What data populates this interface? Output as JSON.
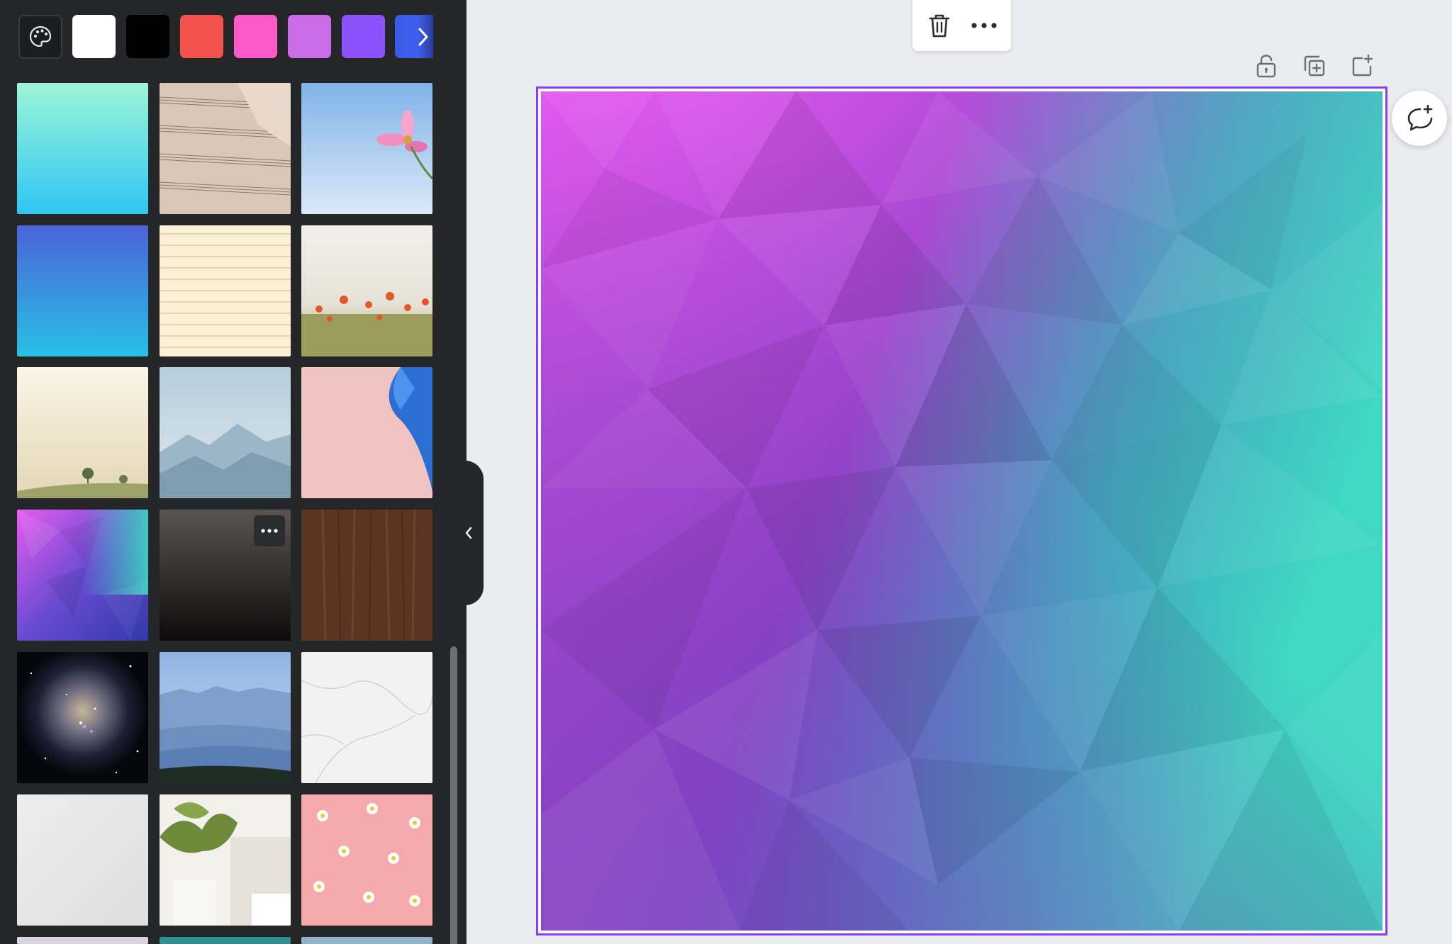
{
  "side_panel": {
    "palette_button": {
      "icon": "palette-icon"
    },
    "color_swatches": [
      {
        "name": "white",
        "color": "#ffffff"
      },
      {
        "name": "black",
        "color": "#000000"
      },
      {
        "name": "coral-red",
        "color": "#f4524d"
      },
      {
        "name": "pink",
        "color": "#ff5bc8"
      },
      {
        "name": "light-purple",
        "color": "#cb6ce6"
      },
      {
        "name": "violet",
        "color": "#8c52ff"
      },
      {
        "name": "blue",
        "color": "#3c5ae8"
      }
    ],
    "swatch_more": {
      "icon": "chevron-right-icon"
    },
    "backgrounds": [
      {
        "id": "mint-gradient"
      },
      {
        "id": "sheet-music"
      },
      {
        "id": "pink-cosmos-sky"
      },
      {
        "id": "blue-gradient-texture"
      },
      {
        "id": "lined-paper"
      },
      {
        "id": "poppy-field"
      },
      {
        "id": "misty-road"
      },
      {
        "id": "misty-mountains"
      },
      {
        "id": "pink-paper-blue-fold"
      },
      {
        "id": "low-poly-gradient"
      },
      {
        "id": "dark-gradient",
        "has_more_menu": true
      },
      {
        "id": "wood-grain"
      },
      {
        "id": "galaxy-nebula"
      },
      {
        "id": "blue-mountain-ridges"
      },
      {
        "id": "white-marble"
      },
      {
        "id": "white-plaster"
      },
      {
        "id": "plant-interior"
      },
      {
        "id": "daisies-on-pink"
      }
    ],
    "collapse_handle": {
      "icon": "chevron-left-icon"
    }
  },
  "toolbar": {
    "delete": {
      "icon": "trash-icon"
    },
    "more": {
      "icon": "more-horizontal-icon"
    }
  },
  "page_actions": [
    {
      "name": "lock-page-button",
      "icon": "unlock-icon"
    },
    {
      "name": "duplicate-page-button",
      "icon": "duplicate-icon"
    },
    {
      "name": "add-page-button",
      "icon": "add-page-icon"
    }
  ],
  "comment_button": {
    "icon": "add-comment-icon"
  },
  "design": {
    "background": "low-poly-gradient",
    "selection_color": "#8b3dff"
  }
}
